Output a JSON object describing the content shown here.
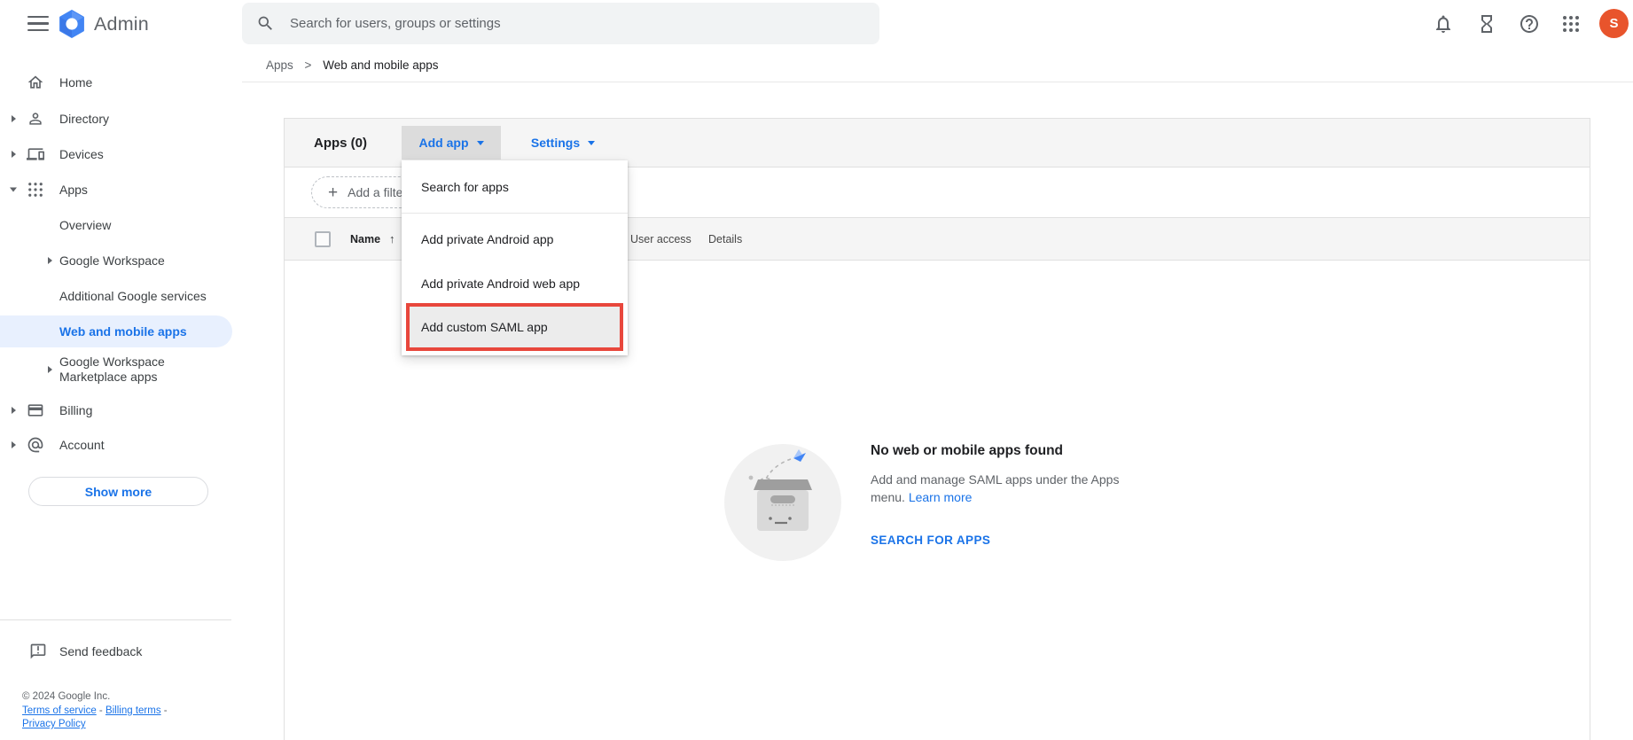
{
  "topbar": {
    "brand": "Admin",
    "search_placeholder": "Search for users, groups or settings",
    "avatar_initial": "S"
  },
  "breadcrumb": {
    "parent": "Apps",
    "separator": ">",
    "current": "Web and mobile apps"
  },
  "sidebar": {
    "items": [
      {
        "label": "Home",
        "icon": "home-icon"
      },
      {
        "label": "Directory",
        "icon": "person-icon",
        "expandable": true
      },
      {
        "label": "Devices",
        "icon": "devices-icon",
        "expandable": true
      },
      {
        "label": "Apps",
        "icon": "apps-grid-icon",
        "expandable": true,
        "expanded": true
      },
      {
        "label": "Overview",
        "sub": true
      },
      {
        "label": "Google Workspace",
        "sub": true,
        "expandable": true
      },
      {
        "label": "Additional Google services",
        "sub": true
      },
      {
        "label": "Web and mobile apps",
        "sub": true,
        "selected": true
      },
      {
        "label": "Google Workspace Marketplace apps",
        "sub": true,
        "expandable": true
      },
      {
        "label": "Billing",
        "icon": "billing-icon",
        "expandable": true
      },
      {
        "label": "Account",
        "icon": "at-icon",
        "expandable": true
      }
    ],
    "show_more_label": "Show more",
    "send_feedback_label": "Send feedback",
    "footer": {
      "copyright": "© 2024 Google Inc.",
      "links": [
        "Terms of service",
        "Billing terms",
        "Privacy Policy"
      ],
      "separator": "-"
    }
  },
  "main": {
    "toolbar": {
      "title": "Apps (0)",
      "add_app_label": "Add app",
      "settings_label": "Settings"
    },
    "filter": {
      "plus": "+",
      "label": "Add a filter"
    },
    "table": {
      "columns": [
        "Name",
        "User access",
        "Details"
      ],
      "sort_arrow": "↑",
      "rows": []
    },
    "menu": {
      "items": [
        "Search for apps",
        "Add private Android app",
        "Add private Android web app",
        "Add custom SAML app"
      ],
      "highlighted_item": "Add custom SAML app"
    },
    "empty_state": {
      "title": "No web or mobile apps found",
      "description": "Add and manage SAML apps under the Apps menu.",
      "learn_more_label": "Learn more",
      "action_label": "SEARCH FOR APPS"
    }
  },
  "colors": {
    "accent": "#1a73e8",
    "annotation_red": "#e8473c",
    "avatar_bg": "#e8542c",
    "selected_item_bg": "#e8f0fe",
    "toolbar_bg": "#f5f5f5"
  }
}
